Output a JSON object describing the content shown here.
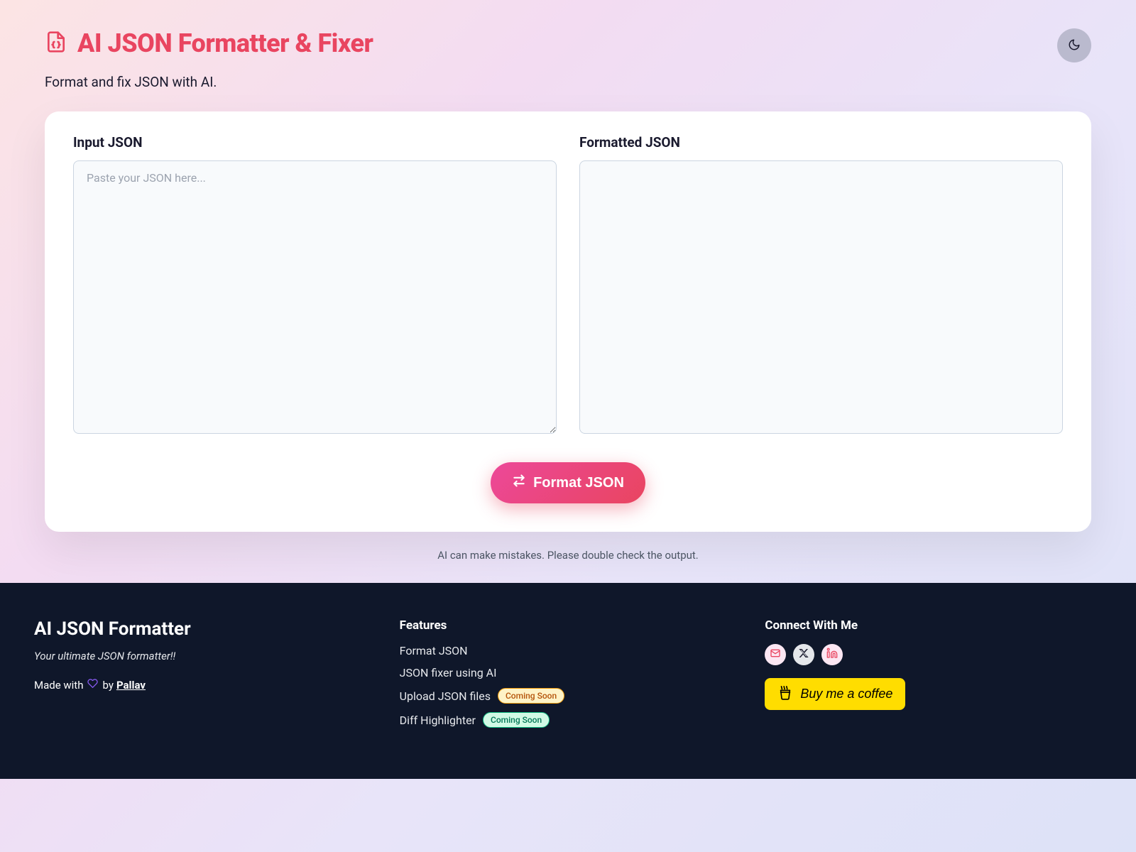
{
  "header": {
    "title": "AI JSON Formatter & Fixer",
    "subtitle": "Format and fix JSON with AI."
  },
  "panels": {
    "input_label": "Input JSON",
    "input_placeholder": "Paste your JSON here...",
    "output_label": "Formatted JSON"
  },
  "actions": {
    "format_button": "Format JSON"
  },
  "disclaimer": "AI can make mistakes. Please double check the output.",
  "footer": {
    "brand_title": "AI JSON Formatter",
    "tagline": "Your ultimate JSON formatter!!",
    "made_with_prefix": "Made with",
    "made_with_suffix": "by",
    "author": "Pallav",
    "features_heading": "Features",
    "features": [
      {
        "label": "Format JSON",
        "badge": null
      },
      {
        "label": "JSON fixer using AI",
        "badge": null
      },
      {
        "label": "Upload JSON files",
        "badge": {
          "text": "Coming Soon",
          "variant": "orange"
        }
      },
      {
        "label": "Diff Highlighter",
        "badge": {
          "text": "Coming Soon",
          "variant": "green"
        }
      }
    ],
    "connect_heading": "Connect With Me",
    "coffee_label": "Buy me a coffee"
  }
}
